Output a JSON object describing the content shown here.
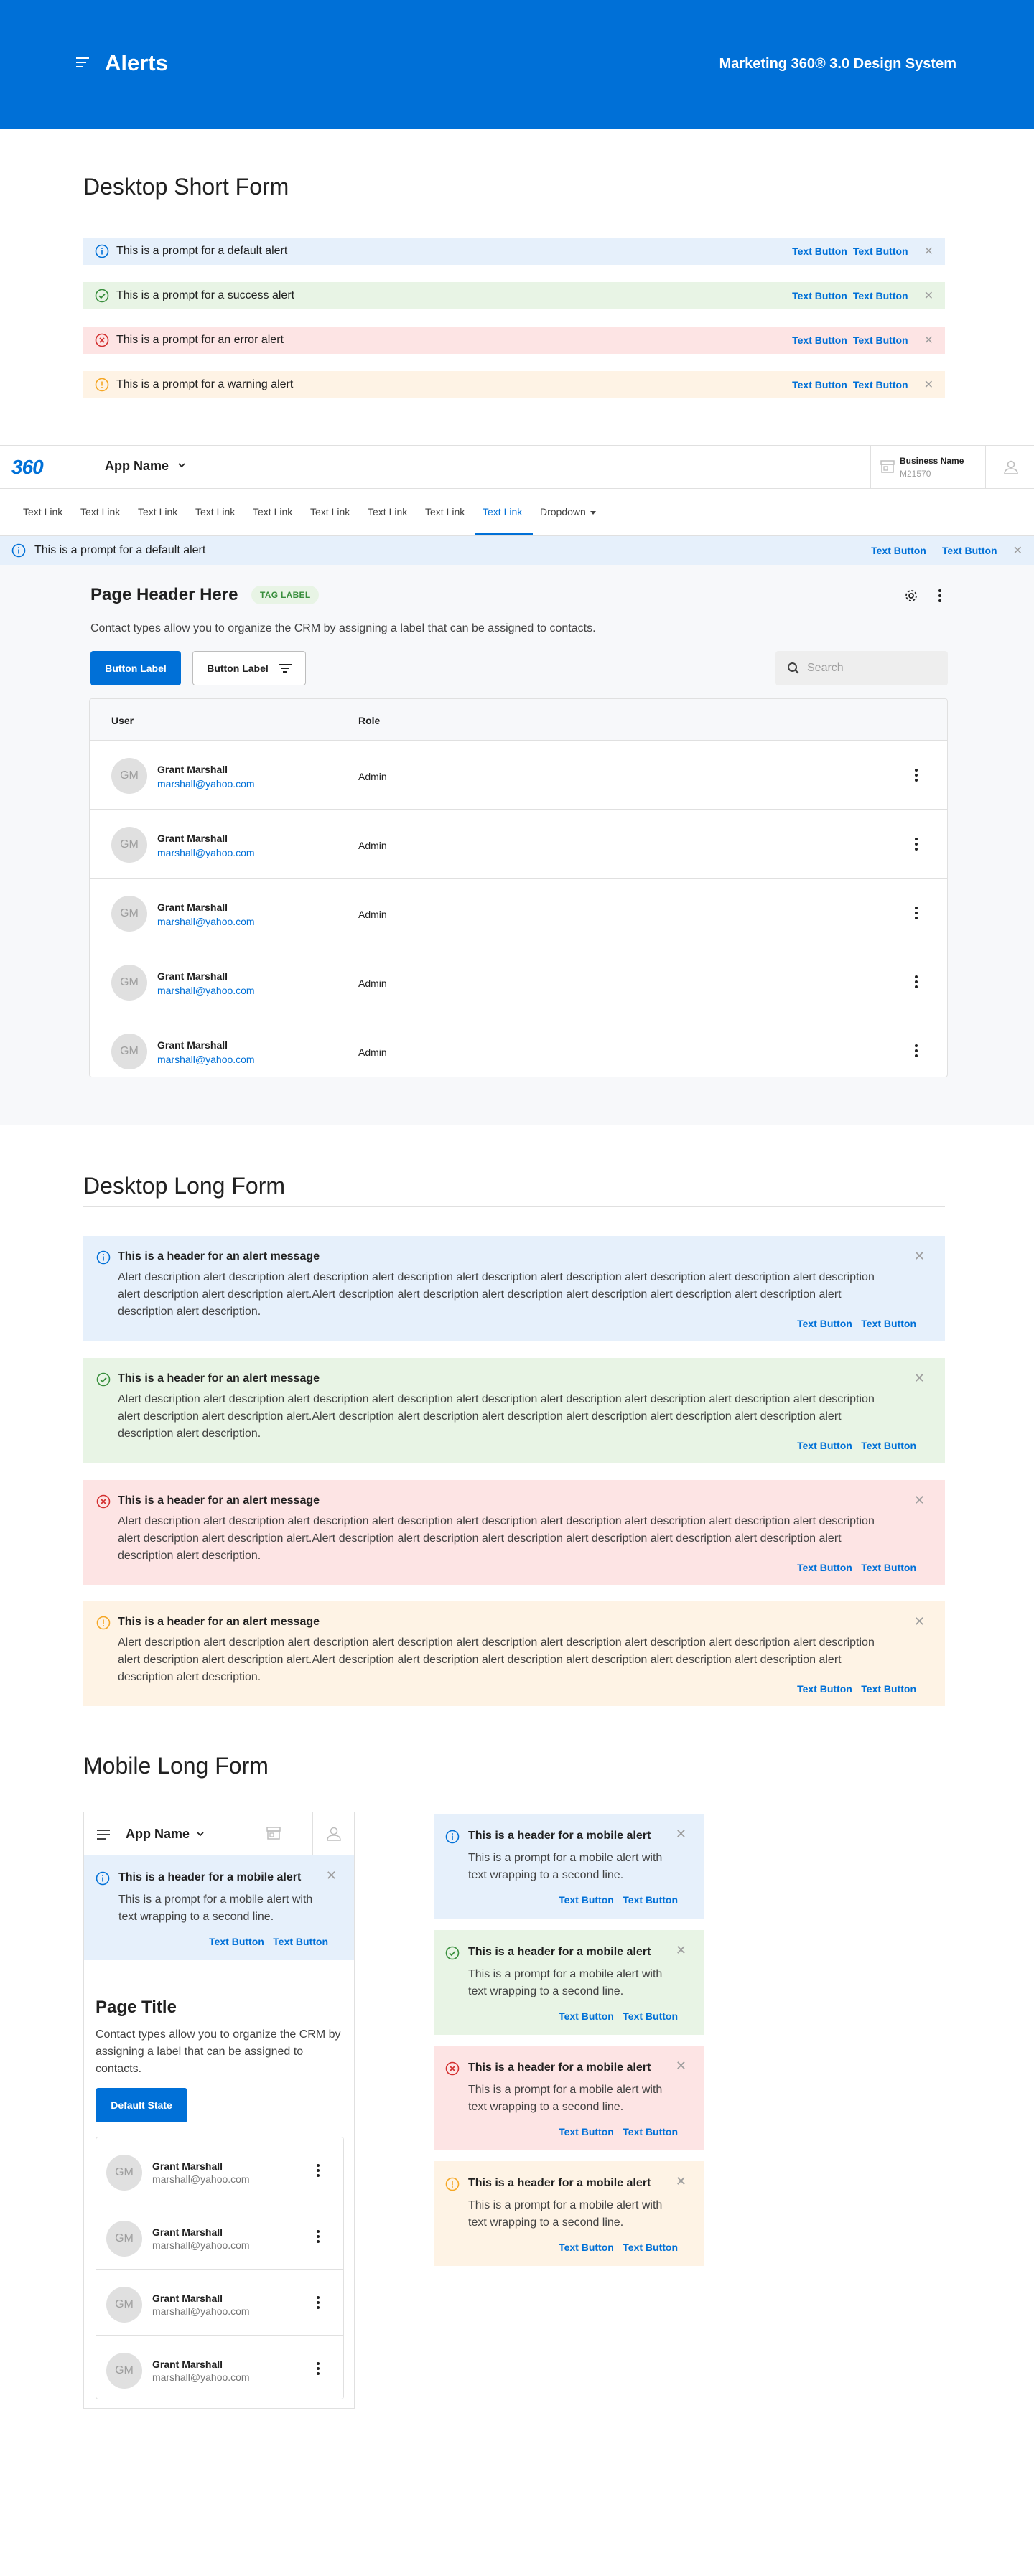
{
  "banner": {
    "title": "Alerts",
    "system": "Marketing 360® 3.0 Design System"
  },
  "sections": {
    "short": "Desktop Short Form",
    "long": "Desktop Long Form",
    "mobile": "Mobile Long Form"
  },
  "short_alerts": [
    {
      "type": "info",
      "text": "This is a prompt for a default alert",
      "action1": "Text Button",
      "action2": "Text Button"
    },
    {
      "type": "success",
      "text": "This is a prompt for a success alert",
      "action1": "Text Button",
      "action2": "Text Button"
    },
    {
      "type": "error",
      "text": "This is a prompt for an error alert",
      "action1": "Text Button",
      "action2": "Text Button"
    },
    {
      "type": "warning",
      "text": "This is a prompt for a warning alert",
      "action1": "Text Button",
      "action2": "Text Button"
    }
  ],
  "app": {
    "logo": "360",
    "app_name": "App Name",
    "business_name": "Business Name",
    "business_id": "M21570",
    "nav": [
      "Text Link",
      "Text Link",
      "Text Link",
      "Text Link",
      "Text Link",
      "Text Link",
      "Text Link",
      "Text Link",
      "Text Link",
      "Dropdown"
    ],
    "alert": {
      "text": "This is a prompt for a default alert",
      "action1": "Text Button",
      "action2": "Text Button"
    },
    "page_title": "Page Header Here",
    "tag": "TAG LABEL",
    "description": "Contact types allow you to organize the CRM by assigning a label that can be assigned to contacts.",
    "primary_button": "Button Label",
    "secondary_button": "Button Label",
    "search_placeholder": "Search",
    "table": {
      "headers": [
        "User",
        "Role"
      ],
      "rows": [
        {
          "initials": "GM",
          "name": "Grant Marshall",
          "email": "marshall@yahoo.com",
          "role": "Admin"
        },
        {
          "initials": "GM",
          "name": "Grant Marshall",
          "email": "marshall@yahoo.com",
          "role": "Admin"
        },
        {
          "initials": "GM",
          "name": "Grant Marshall",
          "email": "marshall@yahoo.com",
          "role": "Admin"
        },
        {
          "initials": "GM",
          "name": "Grant Marshall",
          "email": "marshall@yahoo.com",
          "role": "Admin"
        },
        {
          "initials": "GM",
          "name": "Grant Marshall",
          "email": "marshall@yahoo.com",
          "role": "Admin"
        }
      ]
    }
  },
  "long_alerts": [
    {
      "type": "info",
      "header": "This is a header for an alert message",
      "description": "Alert description alert description alert description alert description alert description alert description alert description alert description alert description alert description alert description alert.Alert description alert description alert description alert description alert description alert description alert description alert description.",
      "action1": "Text Button",
      "action2": "Text Button"
    },
    {
      "type": "success",
      "header": "This is a header for an alert message",
      "description": "Alert description alert description alert description alert description alert description alert description alert description alert description alert description alert description alert description alert.Alert description alert description alert description alert description alert description alert description alert description alert description.",
      "action1": "Text Button",
      "action2": "Text Button"
    },
    {
      "type": "error",
      "header": "This is a header for an alert message",
      "description": "Alert description alert description alert description alert description alert description alert description alert description alert description alert description alert description alert description alert.Alert description alert description alert description alert description alert description alert description alert description alert description.",
      "action1": "Text Button",
      "action2": "Text Button"
    },
    {
      "type": "warning",
      "header": "This is a header for an alert message",
      "description": "Alert description alert description alert description alert description alert description alert description alert description alert description alert description alert description alert description alert.Alert description alert description alert description alert description alert description alert description alert description alert description.",
      "action1": "Text Button",
      "action2": "Text Button"
    }
  ],
  "mobile": {
    "app_name": "App Name",
    "alert": {
      "header": "This is a header for a mobile alert",
      "description": "This is a prompt for a mobile alert with text wrapping to a second line.",
      "action1": "Text Button",
      "action2": "Text Button"
    },
    "page_title": "Page Title",
    "description": "Contact types allow you to organize the CRM by assigning a label that can be assigned to contacts.",
    "button": "Default State",
    "rows": [
      {
        "initials": "GM",
        "name": "Grant Marshall",
        "email": "marshall@yahoo.com"
      },
      {
        "initials": "GM",
        "name": "Grant Marshall",
        "email": "marshall@yahoo.com"
      },
      {
        "initials": "GM",
        "name": "Grant Marshall",
        "email": "marshall@yahoo.com"
      },
      {
        "initials": "GM",
        "name": "Grant Marshall",
        "email": "marshall@yahoo.com"
      }
    ]
  },
  "mobile_alerts": [
    {
      "type": "info",
      "header": "This is a header for a mobile alert",
      "description": "This is a prompt for a mobile alert with text wrapping to a second line.",
      "action1": "Text Button",
      "action2": "Text Button"
    },
    {
      "type": "success",
      "header": "This is a header for a mobile alert",
      "description": "This is a prompt for a mobile alert with text wrapping to a second line.",
      "action1": "Text Button",
      "action2": "Text Button"
    },
    {
      "type": "error",
      "header": "This is a header for a mobile alert",
      "description": "This is a prompt for a mobile alert with text wrapping to a second line.",
      "action1": "Text Button",
      "action2": "Text Button"
    },
    {
      "type": "warning",
      "header": "This is a header for a mobile alert",
      "description": "This is a prompt for a mobile alert with text wrapping to a second line.",
      "action1": "Text Button",
      "action2": "Text Button"
    }
  ],
  "colors": {
    "brand": "#0070d7",
    "info": "#0070d7",
    "success": "#388e3c",
    "error": "#d32f2f",
    "warning": "#f5a623"
  },
  "icons": {
    "info": "info-circle-icon",
    "success": "check-circle-icon",
    "error": "x-circle-icon",
    "warning": "exclamation-circle-icon",
    "close": "close-icon"
  }
}
